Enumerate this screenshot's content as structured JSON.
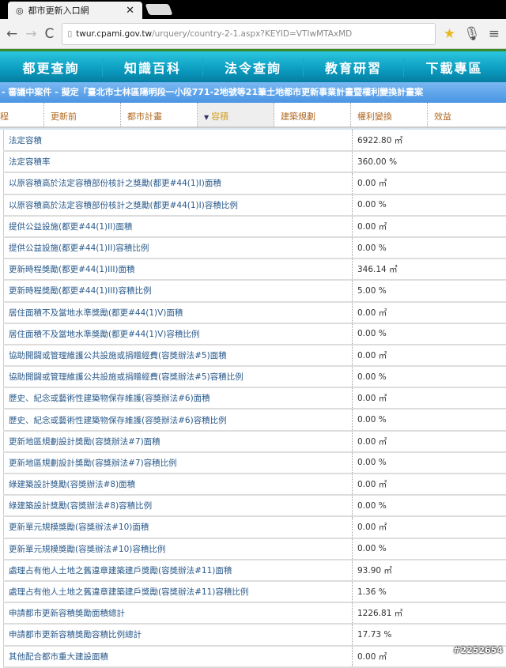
{
  "browser": {
    "tab_title": "都市更新入口網",
    "url_host": "twur.cpami.gov.tw",
    "url_path": "/urquery/country-2-1.aspx?KEYID=VTIwMTAxMD"
  },
  "nav": [
    "都更查詢",
    "知識百科",
    "法令查詢",
    "教育研習",
    "下載專區"
  ],
  "breadcrumb": "- 審議中案件 - 擬定「臺北市士林區陽明段一小段771-2地號等21筆土地都市更新事業計畫暨權利變換計畫案",
  "subtabs": [
    "程",
    "更新前",
    "都市計畫",
    "容積",
    "建築規劃",
    "權利變換",
    "效益"
  ],
  "rows": [
    {
      "label": "法定容積",
      "value": "6922.80 ㎡"
    },
    {
      "label": "法定容積率",
      "value": "360.00 %"
    },
    {
      "label": "以原容積高於法定容積部份核計之獎勵(都更#44(1)I)面積",
      "value": "0.00 ㎡"
    },
    {
      "label": "以原容積高於法定容積部份核計之獎勵(都更#44(1)I)容積比例",
      "value": "0.00 %"
    },
    {
      "label": "提供公益設施(都更#44(1)II)面積",
      "value": "0.00 ㎡"
    },
    {
      "label": "提供公益設施(都更#44(1)II)容積比例",
      "value": "0.00 %"
    },
    {
      "label": "更新時程獎勵(都更#44(1)III)面積",
      "value": "346.14 ㎡"
    },
    {
      "label": "更新時程獎勵(都更#44(1)III)容積比例",
      "value": "5.00 %"
    },
    {
      "label": "居住面積不及當地水準獎勵(都更#44(1)V)面積",
      "value": "0.00 ㎡"
    },
    {
      "label": "居住面積不及當地水準獎勵(都更#44(1)V)容積比例",
      "value": "0.00 %"
    },
    {
      "label": "協助開闢或管理維護公共設施或捐贈經費(容獎辦法#5)面積",
      "value": "0.00 ㎡"
    },
    {
      "label": "協助開闢或管理維護公共設施或捐贈經費(容獎辦法#5)容積比例",
      "value": "0.00 %"
    },
    {
      "label": "歷史、紀念或藝術性建築物保存維護(容獎辦法#6)面積",
      "value": "0.00 ㎡"
    },
    {
      "label": "歷史、紀念或藝術性建築物保存維護(容獎辦法#6)容積比例",
      "value": "0.00 %"
    },
    {
      "label": "更新地區規劃設計獎勵(容獎辦法#7)面積",
      "value": "0.00 ㎡"
    },
    {
      "label": "更新地區規劃設計獎勵(容獎辦法#7)容積比例",
      "value": "0.00 %"
    },
    {
      "label": "綠建築設計獎勵(容獎辦法#8)面積",
      "value": "0.00 ㎡"
    },
    {
      "label": "綠建築設計獎勵(容獎辦法#8)容積比例",
      "value": "0.00 %"
    },
    {
      "label": "更新單元規模獎勵(容獎辦法#10)面積",
      "value": "0.00 ㎡"
    },
    {
      "label": "更新單元規模獎勵(容獎辦法#10)容積比例",
      "value": "0.00 %"
    },
    {
      "label": "處理占有他人土地之舊違章建築建戶獎勵(容獎辦法#11)面積",
      "value": "93.90 ㎡"
    },
    {
      "label": "處理占有他人土地之舊違章建築建戶獎勵(容獎辦法#11)容積比例",
      "value": "1.36 %"
    },
    {
      "label": "申請都市更新容積獎勵面積總計",
      "value": "1226.81 ㎡"
    },
    {
      "label": "申請都市更新容積獎勵容積比例總計",
      "value": "17.73 %"
    },
    {
      "label": "其他配合都市重大建設面積",
      "value": "0.00 ㎡"
    }
  ],
  "watermark": "#2252654"
}
